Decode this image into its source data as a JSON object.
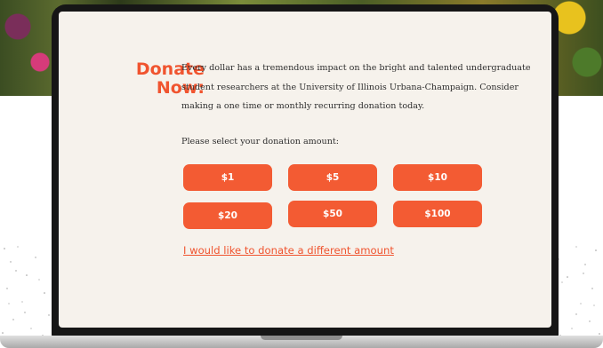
{
  "heading": {
    "line1": "Donate",
    "line2": "Now:"
  },
  "intro": "Every dollar has a tremendous impact on the bright and talented undergraduate student researchers at the University of Illinois Urbana-Champaign. Consider making a one time or monthly recurring donation today.",
  "prompt": "Please select your donation amount:",
  "amounts": [
    "$1",
    "$5",
    "$10",
    "$20",
    "$50",
    "$100"
  ],
  "custom_link": "I would like to donate a different amount",
  "colors": {
    "accent": "#f35b33",
    "screen_background": "#f6f2ec",
    "text": "#2e2e2e",
    "laptop_bezel": "#161616"
  }
}
